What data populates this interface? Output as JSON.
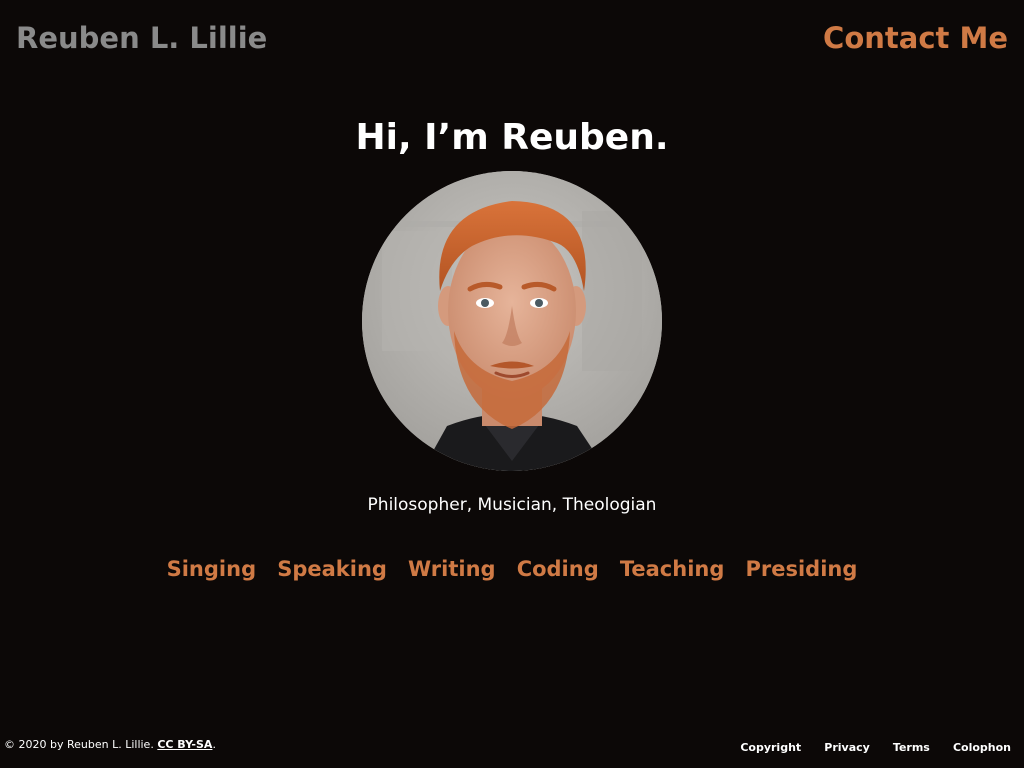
{
  "header": {
    "site_name": "Reuben L. Lillie",
    "contact_label": "Contact Me"
  },
  "hero": {
    "greeting": "Hi, I’m Reuben.",
    "portrait_alt": "Portrait of Reuben L. Lillie",
    "tagline": "Philosopher, Musician, Theologian"
  },
  "skills_nav": {
    "items": [
      {
        "label": "Singing"
      },
      {
        "label": "Speaking"
      },
      {
        "label": "Writing"
      },
      {
        "label": "Coding"
      },
      {
        "label": "Teaching"
      },
      {
        "label": "Presiding"
      }
    ]
  },
  "footer": {
    "copyright_text": "© 2020 by Reuben L. Lillie. ",
    "license_label": "CC BY-SA",
    "license_suffix": ".",
    "links": [
      {
        "label": "Copyright"
      },
      {
        "label": "Privacy"
      },
      {
        "label": "Terms"
      },
      {
        "label": "Colophon"
      }
    ]
  },
  "colors": {
    "background": "#0c0807",
    "accent": "#d07a45",
    "site_name": "#8a8a8a",
    "text": "#ffffff"
  }
}
